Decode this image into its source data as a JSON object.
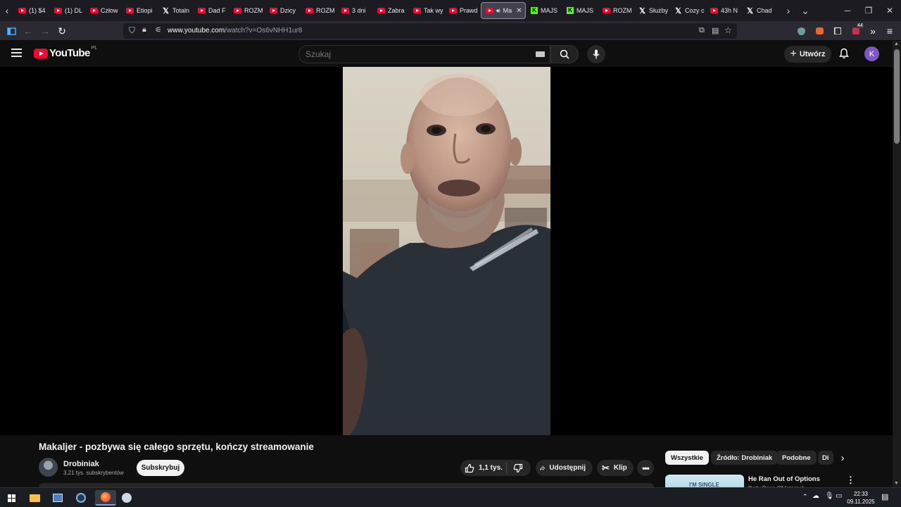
{
  "browser": {
    "tabs": [
      {
        "label": "(1) $4",
        "icon": "youtube"
      },
      {
        "label": "(1) DL",
        "icon": "youtube"
      },
      {
        "label": "Człow",
        "icon": "youtube"
      },
      {
        "label": "Etiopi",
        "icon": "youtube"
      },
      {
        "label": "Totaln",
        "icon": "x"
      },
      {
        "label": "Dad F",
        "icon": "youtube"
      },
      {
        "label": "ROZM",
        "icon": "youtube"
      },
      {
        "label": "Dzicy",
        "icon": "youtube"
      },
      {
        "label": "ROZM",
        "icon": "youtube"
      },
      {
        "label": "3 dni",
        "icon": "youtube"
      },
      {
        "label": "Zabra",
        "icon": "youtube"
      },
      {
        "label": "Tak wy",
        "icon": "youtube"
      },
      {
        "label": "Prawd",
        "icon": "youtube"
      },
      {
        "label": "Ma",
        "icon": "youtube",
        "active": true
      },
      {
        "label": "MAJS",
        "icon": "kick"
      },
      {
        "label": "MAJS",
        "icon": "kick"
      },
      {
        "label": "ROZM",
        "icon": "youtube"
      },
      {
        "label": "Służby",
        "icon": "x"
      },
      {
        "label": "Cozy c",
        "icon": "x"
      },
      {
        "label": "43h N",
        "icon": "youtube"
      },
      {
        "label": "Chad",
        "icon": "x"
      }
    ],
    "url_host": "www.youtube.com",
    "url_path": "/watch?v=Os6vNHH1ur8",
    "extension_badge": "44"
  },
  "youtube": {
    "logo_text": "YouTube",
    "region": "PL",
    "search_placeholder": "Szukaj",
    "create_label": "Utwórz",
    "avatar_letter": "K"
  },
  "video": {
    "title": "Makaljer - pozbywa się całego sprzętu, kończy streamowanie",
    "channel": "Drobiniak",
    "subscribers": "3,21 tys. subskrybentów",
    "subscribe_label": "Subskrybuj",
    "likes": "1,1 tys.",
    "share_label": "Udostępnij",
    "clip_label": "Klip"
  },
  "sidebar": {
    "chips": [
      "Wszystkie",
      "Źródło: Drobiniak",
      "Podobne",
      "Di"
    ],
    "recommended": {
      "title": "He Ran Out of Options",
      "channel": "Daily Dose Of Internet",
      "thumb_text": "I'M SINGLE"
    }
  },
  "taskbar": {
    "time": "22:33",
    "date": "09.11.2025"
  }
}
